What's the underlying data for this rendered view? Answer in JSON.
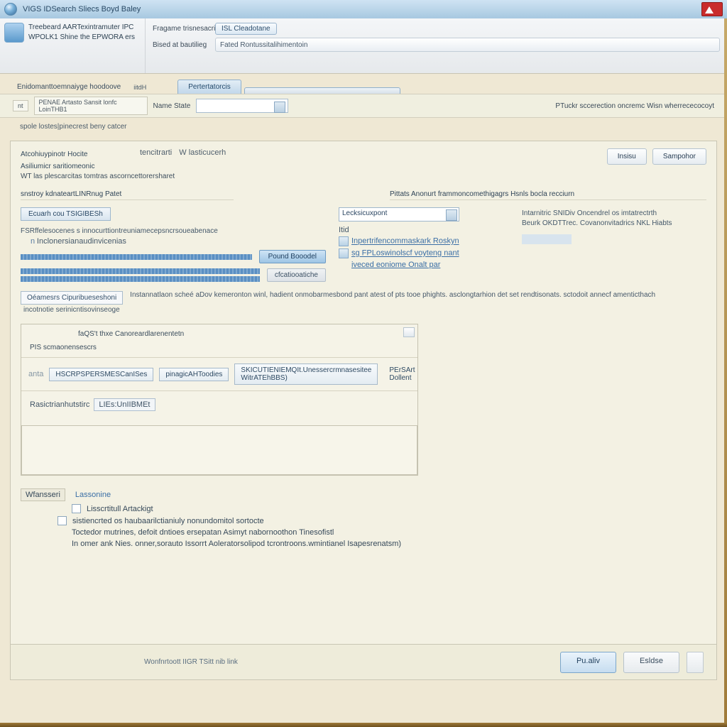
{
  "window": {
    "title": "VIGS IDSearch Sliecs Boyd Baley"
  },
  "header": {
    "line1": "Treebeard AARTexintramuter IPC",
    "line2": "WPOLK1 Shine the EPWORA ers",
    "row1_label": "Fragame trisnesacri",
    "row1_button": "ISL Cleadotane",
    "row2_label": "Bised at bautilieg",
    "row2_field": "Fated Rontussitalihimentoin"
  },
  "tabstrip": {
    "crumb": "Enidomanttoemnaiyge hoodoove",
    "mini": "iitdH",
    "tab": "Pertertatorcis"
  },
  "filter": {
    "seg_a": "nt",
    "seg_b": "PENAE Artasto Sansit lonfc LoinTHB1",
    "label": "Name State",
    "select_value": "",
    "right_label": "PTuckr sccerection oncremc Wisn wherrececocoyt",
    "sub_a": "spole lostes|pinecrest beny catcer"
  },
  "side": {
    "item1": "Atcohiuypinotr Hocite",
    "item2": "Asiliumicr saritiomeonic"
  },
  "centertabs": {
    "a": "tencitrarti",
    "b": "W lasticucerh"
  },
  "desc": "WT las plescarcitas tomtras ascorncettorersharet",
  "topbuttons": {
    "a": "Insisu",
    "b": "Sampohor"
  },
  "sections": {
    "left_hd": "snstroy kdnateartLINRnug Patet",
    "right_hd": "Pittats  Anonurt frammoncomethigagrs Hsnls bocla recciurn"
  },
  "mid_left": {
    "btn": "Ecuarh cou TSIGIBESh",
    "line1": "FSRffelesocenes s   innocurttiontreuniamecepsncrsoueabenace",
    "line2": "Inclonersianaudinvicenias",
    "btn_blue": "Pound Booodel",
    "btn_grey": "cfcatiooatiche"
  },
  "mid_center": {
    "select": "Lecksicuxpont",
    "hint": "Itid",
    "link1": "Inpertrifencommaskark Roskyn",
    "link2": "sg FPLoswinolscf voyteng nant",
    "link3": "iveced eoniome Onalt par"
  },
  "mid_right": {
    "line1": "Intarnitric SNIDiv Oncendrel os imtatrectrth",
    "line2": "Beurk OKDTTrec. Covanonvitadrics NKL Hiabts"
  },
  "infostrip": {
    "btn": "Oéamesrs Cipuribueseshoni",
    "text": "Instannatlaon scheé aDov kemeronton winl, hadient onmobarmesbond pant atest of pts tooe phights. asclongtarhion det set rendtisonats. sctodoit annecf amenticthach",
    "sub": "incotnotie serinicntisovinseoge"
  },
  "card": {
    "head_r": "faQS't thxe Canoreardlarenentetn",
    "head_l": "PIS scmaonensescrs",
    "btn_lead": "anta",
    "drop1": "HSCRPSPERSMESCanISes",
    "drop2": "pinagicAHToodies",
    "drop3": "SKICUTIENIEMQIt.Unessercrmnasesitee WitrATEhBBS)",
    "after": "PErSArt Dollent",
    "sub_label": "Rasictrianhutstirc",
    "sub_field": "LIEs:UnIIBMEt"
  },
  "opts": {
    "tab": "Wfansseri",
    "a": "Lassonine",
    "b": "Lisscrtitull Artackigt",
    "c": "sistiencrted os haubaarilctianiuly nonundomitol sortocte",
    "d": "Toctedor mutrines, defoit dntioes ersepatan Asimyt nabornoothon Tinesofistl",
    "e": "In omer ank Nies. onner,sorauto Issorrt  Aoleratorsolipod tcrontroons.wmintianel Isapesrenatsm)"
  },
  "footer": {
    "status": "Wonfnrtoott IIGR TSitt nib link",
    "primary": "Pu.aliv",
    "secondary": "Esldse"
  }
}
